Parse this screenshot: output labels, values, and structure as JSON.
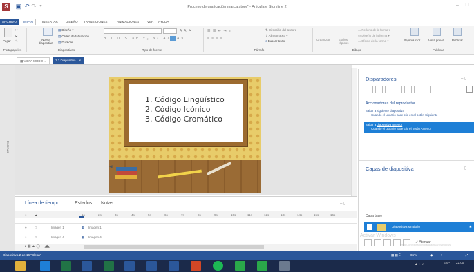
{
  "app": {
    "title": "Proceso de graficación marca.story* - Articulate Storyline 2",
    "win_minimize": "–",
    "win_close": "□"
  },
  "ribbon": {
    "tabs": [
      "ARCHIVO",
      "INICIO",
      "INSERTAR",
      "DISEÑO",
      "TRANSICIONES",
      "ANIMACIONES",
      "VER",
      "AYUDA"
    ],
    "paste": "Pegar",
    "new_slide_1": "Nueva",
    "new_slide_2": "diapositiva",
    "slides_items": [
      "Diseño",
      "Orden de tabulación",
      "Duplicar"
    ],
    "groups": [
      "Portapapeles",
      "Diapositivas",
      "Tipo de fuente",
      "Párrafo",
      "Dibujo",
      "Publicar"
    ],
    "paragraph_items": [
      "Dirección del texto",
      "Alinear texto",
      "Buscar texto"
    ],
    "draw_items": [
      "Organizar",
      "Estilos rápidos"
    ],
    "shape_items": [
      "Relleno de la forma",
      "Diseño de la forma",
      "Efecto de la forma"
    ],
    "publish_items": [
      "Reproductor",
      "Vista previa",
      "Publicar"
    ]
  },
  "doc_tabs": [
    "VISTA MODO ...",
    "1.2 Diapositiva..."
  ],
  "side_label": "Escenas",
  "slide": {
    "items": [
      "1. Código Lingüístico",
      "2. Código Icónico",
      "3. Código Cromático"
    ]
  },
  "timeline": {
    "tabs": [
      "Línea de tiempo",
      "Estados",
      "Notas"
    ],
    "ticks": [
      "1s",
      "2s",
      "3s",
      "4s",
      "5s",
      "6s",
      "7s",
      "8s",
      "9s",
      "10s",
      "11s",
      "12s",
      "13s",
      "14s",
      "15s",
      "16s"
    ],
    "rows": [
      {
        "name": "Imagen 1",
        "label": "Imagen 1"
      },
      {
        "name": "Imagen 4",
        "label": "Imagen 4"
      }
    ]
  },
  "triggers": {
    "title": "Disparadores",
    "section": "Accionadores del reproductor",
    "items": [
      {
        "action": "Saltar a",
        "link": "siguiente diapositiva",
        "when": "Cuando el usuario hace clic en el botón Siguiente"
      },
      {
        "action": "Saltar a",
        "link": "diapositiva anterior",
        "when": "Cuando el usuario hace clic el botón Anterior"
      }
    ]
  },
  "layers": {
    "title": "Capas de diapositiva",
    "base_label": "Capa base",
    "base_item": "Diapositiva sin título",
    "watermark_1": "Activar Windows",
    "watermark_2": "Ve a Configuración para activar Windows.",
    "check_label": "Atenuar"
  },
  "status": {
    "text": "Diapositiva 2 de 16  \"Clean\"",
    "zoom": "65%"
  },
  "taskbar": {
    "time": "22:00",
    "date": "ESP"
  },
  "colors": {
    "accent": "#2b579a",
    "selected": "#1e7fd6",
    "wood": "#8a6a3a",
    "board": "#fdfdfd",
    "frame": "#9c6b2f"
  }
}
